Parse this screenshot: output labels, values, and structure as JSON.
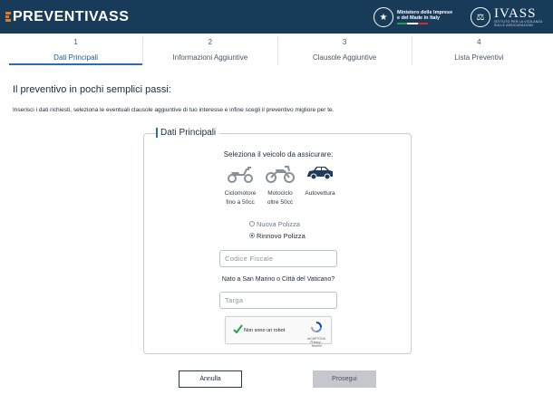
{
  "header": {
    "logo_text": "PREVENTIVASS",
    "ministry_line1": "Ministero delle Imprese",
    "ministry_line2": "e del Made in Italy",
    "ivass_text": "IVASS",
    "ivass_sub": "ISTITUTO PER LA VIGILANZA SULLE ASSICURAZIONI"
  },
  "steps": [
    {
      "num": "1",
      "label": "Dati Principali",
      "active": true
    },
    {
      "num": "2",
      "label": "Informazioni Aggiuntive",
      "active": false
    },
    {
      "num": "3",
      "label": "Clausole Aggiuntive",
      "active": false
    },
    {
      "num": "4",
      "label": "Lista Preventivi",
      "active": false
    }
  ],
  "main": {
    "title": "Il preventivo in pochi semplici passi:",
    "subtitle": "Inserisci i dati richiesti, seleziona le eventuali clausole aggiuntive di tuo interesse e infine scegli il preventivo migliore per te."
  },
  "form": {
    "legend": "Dati Principali",
    "vehicle_title": "Seleziona il veicolo da assicurare:",
    "vehicles": [
      {
        "line1": "Ciclomotore",
        "line2": "fino a 50cc",
        "icon": "moped-icon"
      },
      {
        "line1": "Motociclo",
        "line2": "oltre 50cc",
        "icon": "motorcycle-icon"
      },
      {
        "line1": "Autovettura",
        "line2": "",
        "icon": "car-icon"
      }
    ],
    "policy_new": "Nuova Polizza",
    "policy_renew": "Rinnovo Polizza",
    "selected_policy": "Rinnovo Polizza",
    "codice_fiscale_placeholder": "Codice Fiscale",
    "nato_question": "Nato a San Marino o Città del Vaticano?",
    "targa_placeholder": "Targa",
    "captcha_label": "Non sono un robot",
    "captcha_brand": "reCAPTCHA",
    "captcha_links": "Privacy - Termini"
  },
  "actions": {
    "cancel": "Annulla",
    "next": "Prosegui"
  },
  "colors": {
    "header_bg": "#183b5a",
    "accent": "#2a6fa8",
    "logo_accent": "#e07b1f",
    "disabled_btn": "#c4c7cb"
  }
}
